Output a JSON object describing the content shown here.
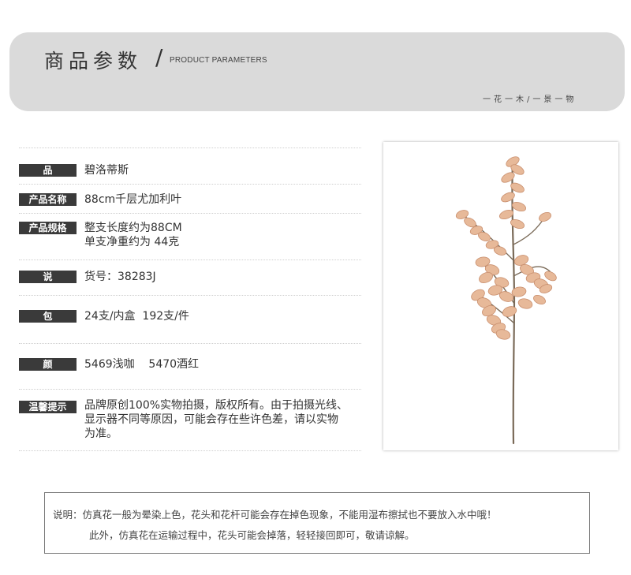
{
  "header": {
    "title": "商品参数",
    "slash": "/",
    "subtitle": "PRODUCT PARAMETERS",
    "motto": "一花一木/一景一物"
  },
  "specs": [
    {
      "label": "品 牌",
      "value": "碧洛蒂斯"
    },
    {
      "label": "产品名称",
      "value": "88cm千层尤加利叶"
    },
    {
      "label": "产品规格",
      "value": "整支长度约为88CM\n单支净重约为 44克"
    },
    {
      "label": "说 明",
      "value": "货号：38283J"
    },
    {
      "label": "包 装",
      "value": "24支/内盒  192支/件"
    },
    {
      "label": "颜 色",
      "value": "5469浅咖    5470酒红"
    },
    {
      "label": "温馨提示",
      "value": "品牌原创100%实物拍摄，版权所有。由于拍摄光线、\n显示器不同等原因，可能会存在些许色差，请以实物\n为准。"
    }
  ],
  "note": {
    "line1": "说明：仿真花一般为晕染上色，花头和花杆可能会存在掉色现象，不能用湿布擦拭也不要放入水中哦！",
    "line2": "此外，仿真花在运输过程中，花头可能会掉落，轻轻接回即可，敬请谅解。"
  },
  "colors": {
    "banner": "#dadada",
    "tag": "#3a3a3a",
    "stem": "#7a6a58",
    "leaf": "#e7b999",
    "leaf_edge": "#c98f6e"
  }
}
